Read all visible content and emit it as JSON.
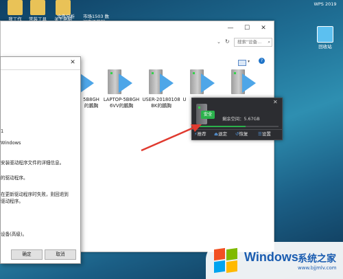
{
  "desktop": {
    "icons": [
      {
        "label": "我工作"
      },
      {
        "label": "常装工具"
      },
      {
        "label": "关于电脑"
      },
      {
        "label": "文件分析\ndoc"
      },
      {
        "label": "市场1503 数\n据市场营销..."
      },
      {
        "label": "WPS 2019"
      },
      {
        "label": "回收站"
      }
    ]
  },
  "explorer": {
    "search_placeholder": "搜索\"设备...",
    "drives": [
      {
        "label": "5B8GH\n的鵬胸"
      },
      {
        "label": "LAPTOP-5B8GH\n6VV的鵬胸"
      },
      {
        "label": "USER-20180108\nBK的鵬胸"
      },
      {
        "label": "U"
      }
    ]
  },
  "dialog": {
    "lines": [
      "1",
      "Windows",
      "安装驱动程序文件的详细信息。",
      "的驱动程序。",
      "在更新驱动程序时失败，则回退到",
      "驱动程序。",
      "设备(高级)。"
    ],
    "ok_label": "确定",
    "cancel_label": "取消"
  },
  "widget": {
    "badge": "安全",
    "free_space": "剩余空间：5.67GB",
    "tabs": [
      "推荐",
      "退定",
      "恢复",
      "设置"
    ]
  },
  "watermark": {
    "brand": "Windows",
    "site_name": "系统之家",
    "site_url": "www.bjjmlv.com"
  },
  "colors": {
    "accent_blue": "#4ea6e8",
    "safe_green": "#2bb24c",
    "annotation_red": "#e03a2f"
  }
}
